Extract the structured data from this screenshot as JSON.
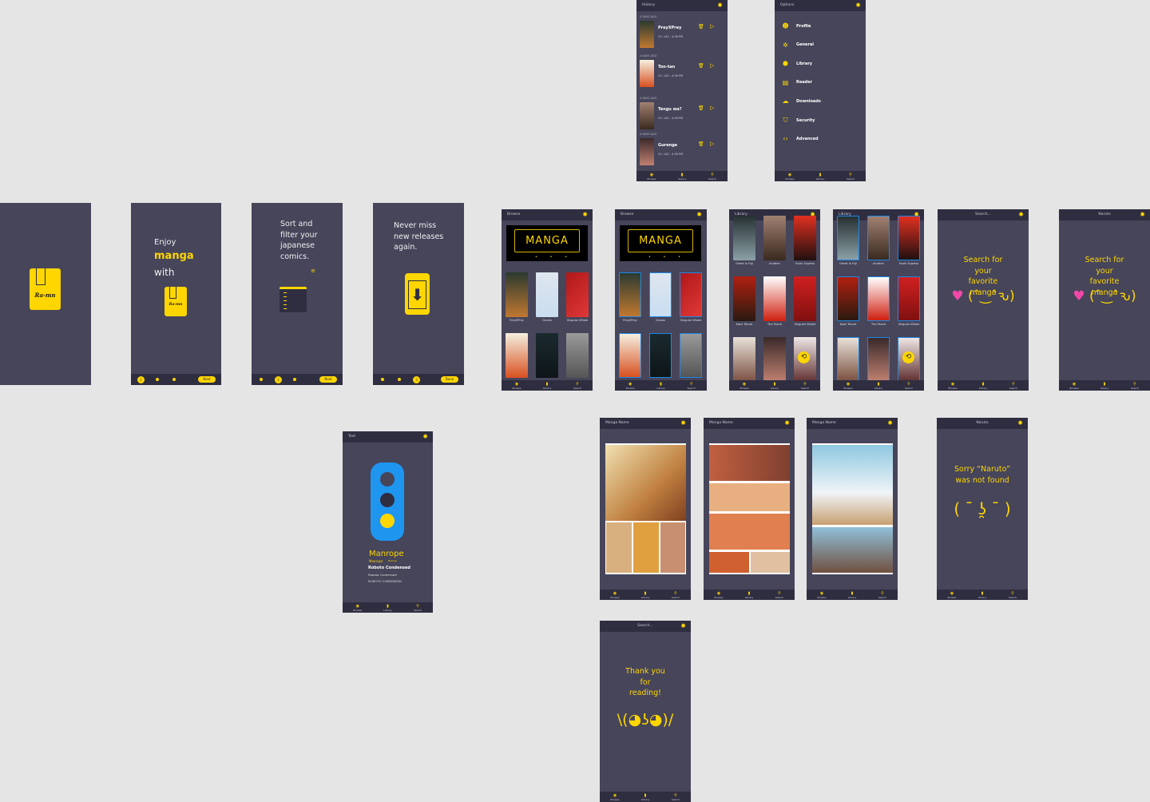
{
  "colors": {
    "canvas": "#e5e5e5",
    "screen": "#46455a",
    "bar": "#2f2e41",
    "accent": "#ffd600",
    "selection": "#1e88e5"
  },
  "nav": {
    "items": [
      {
        "label": "Browse",
        "icon": "compass-icon"
      },
      {
        "label": "Library",
        "icon": "book-icon"
      },
      {
        "label": "Search",
        "icon": "search-icon"
      }
    ]
  },
  "screens": {
    "splash": {
      "logo_text": "Ra-mn"
    },
    "onboard1": {
      "line1": "Enjoy",
      "highlight": "manga",
      "line3": "with",
      "logo_text": "Ra-mn",
      "step": "1",
      "button": "Next"
    },
    "onboard2": {
      "text": "Sort and filter your japanese comics.",
      "step": "2",
      "button": "Next"
    },
    "onboard3": {
      "text": "Never miss new releases again.",
      "step": "3",
      "button": "Done"
    },
    "history": {
      "title": "History",
      "entries": [
        {
          "date": "4 DAYS AGO",
          "title": "PreyXPrey",
          "meta": "Ch. 140 - 4:56 PM"
        },
        {
          "date": "4 DAYS AGO",
          "title": "Ton-tan",
          "meta": "Ch. 140 - 4:56 PM"
        },
        {
          "date": "4 DAYS AGO",
          "title": "Tengu wa?",
          "meta": "Ch. 140 - 4:56 PM"
        },
        {
          "date": "4 DAYS AGO",
          "title": "Gurenge",
          "meta": "Ch. 140 - 4:56 PM"
        }
      ]
    },
    "options": {
      "title": "Options",
      "items": [
        {
          "label": "Profile",
          "icon": "smiley-icon"
        },
        {
          "label": "General",
          "icon": "settings-icon"
        },
        {
          "label": "Library",
          "icon": "library-icon"
        },
        {
          "label": "Reader",
          "icon": "reader-icon"
        },
        {
          "label": "Downloads",
          "icon": "cloud-download-icon"
        },
        {
          "label": "Security",
          "icon": "shield-icon"
        },
        {
          "label": "Advanced",
          "icon": "code-icon"
        }
      ]
    },
    "browse1": {
      "title": "Browse",
      "banner": "MANGA",
      "covers": [
        "PreyXPrey",
        "Clonex",
        "Singular Whale",
        "",
        "",
        ""
      ]
    },
    "browse2": {
      "title": "Browse",
      "banner": "MANGA",
      "covers": [
        "PreyXPrey",
        "Clonex",
        "Singular Whale",
        "",
        "",
        ""
      ]
    },
    "library1": {
      "title": "Library",
      "covers": [
        "Greek in Fuji",
        "Another",
        "Sushi Express",
        "Kami Tenzei",
        "The Parrot",
        "Singular Whale",
        "",
        "",
        ""
      ]
    },
    "library2": {
      "title": "Library",
      "covers": [
        "Greek in Fuji",
        "Another",
        "Sushi Express",
        "Kami Tenzei",
        "The Parrot",
        "Singular Whale",
        "",
        "",
        ""
      ]
    },
    "search1": {
      "title": "Search...",
      "message": "Search for your favorite manga",
      "kaomoji": "(ˆ‿ˆԅ)"
    },
    "search2": {
      "title": "Naruto",
      "message": "Search for your favorite manga",
      "kaomoji": "(ˆ‿ˆԅ)"
    },
    "text": {
      "title": "Text",
      "font1": "Manrope",
      "font1_small": "Manrope",
      "font1_tiny": "Manrope",
      "font2_bold": "Roboto Condensed",
      "font2_regular": "Roboto Condensed",
      "font2_caps": "ROBOTO CONDENSED"
    },
    "reader1": {
      "title": "Manga Name"
    },
    "reader2": {
      "title": "Manga Name"
    },
    "reader3": {
      "title": "Manga Name"
    },
    "notfound": {
      "title": "Naruto",
      "message": "Sorry “Naruto” was not found",
      "kaomoji": "( ¯ ʖ̯ ¯ )"
    },
    "thanks": {
      "title": "Search...",
      "message": "Thank you for reading!",
      "kaomoji": "\\(◕ʖ◕)/"
    }
  }
}
